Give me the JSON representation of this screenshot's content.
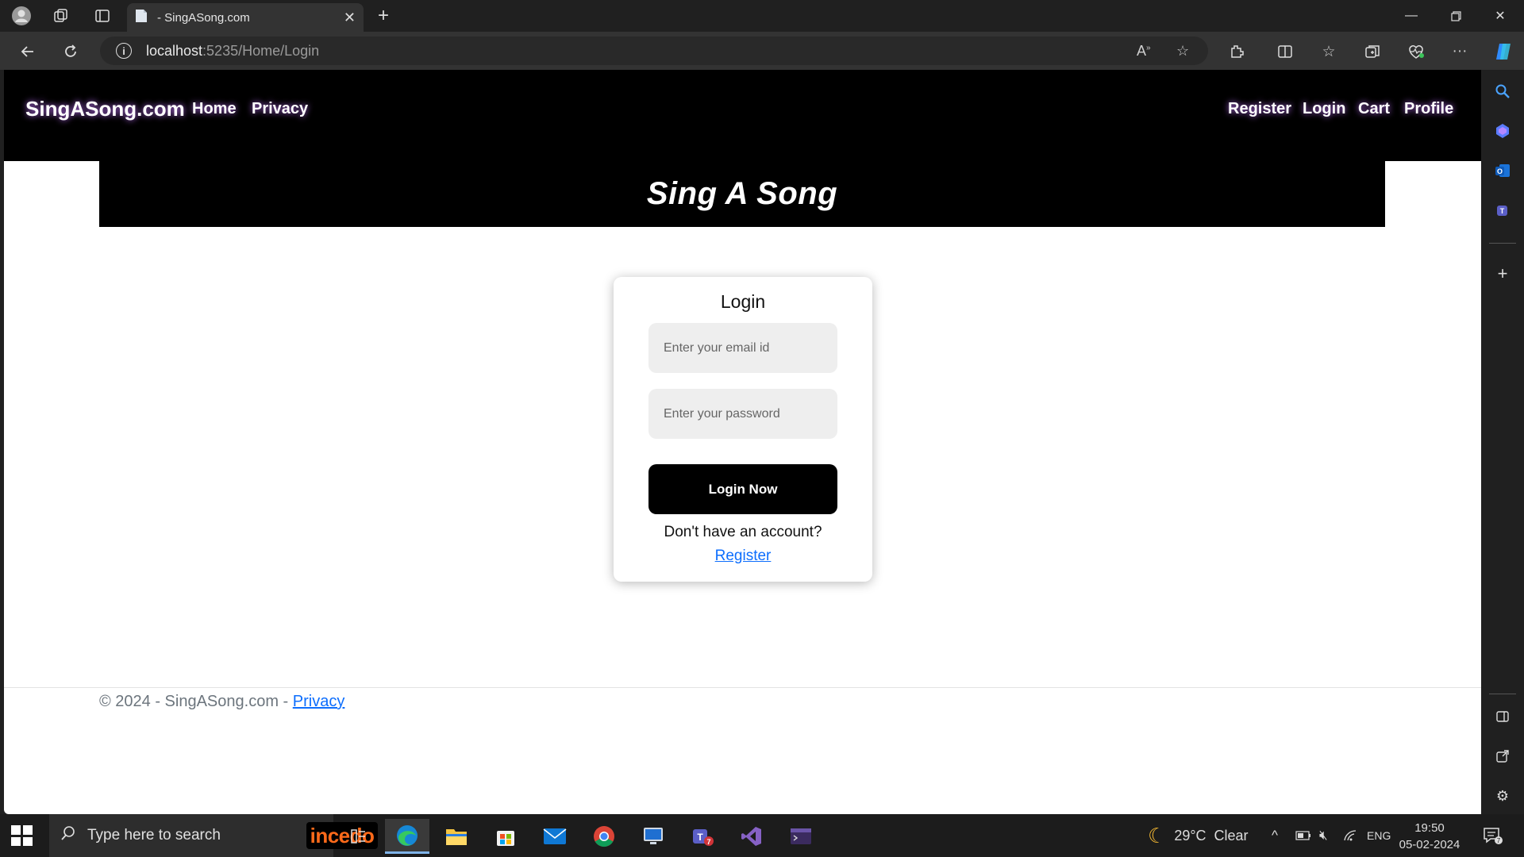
{
  "browser": {
    "tab_title": "- SingASong.com",
    "url_host": "localhost",
    "url_rest": ":5235/Home/Login"
  },
  "site": {
    "brand": "SingASong.com",
    "nav_left": [
      "Home",
      "Privacy"
    ],
    "nav_right": [
      "Register",
      "Login",
      "Cart",
      "Profile"
    ],
    "banner_title": "Sing A Song"
  },
  "login": {
    "title": "Login",
    "email_placeholder": "Enter your email id",
    "password_placeholder": "Enter your password",
    "button_label": "Login Now",
    "no_account_text": "Don't have an account?",
    "register_link": "Register"
  },
  "footer": {
    "text": "© 2024 - SingASong.com - ",
    "privacy_link": "Privacy"
  },
  "taskbar": {
    "search_placeholder": "Type here to search",
    "pinned_logo_text": "incedo",
    "weather": "29°C  Clear",
    "language": "ENG",
    "time": "19:50",
    "date": "05-02-2024",
    "notification_count": "7"
  }
}
